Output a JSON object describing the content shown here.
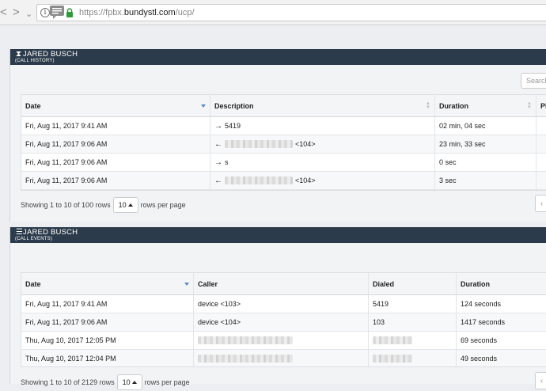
{
  "browser": {
    "back": "<",
    "forward": ">",
    "dropdown": "⌄",
    "url_prefix": "https://fpbx.",
    "url_domain": "bundystl.com",
    "url_path": "/ucp/"
  },
  "history_widget": {
    "title": "JARED BUSCH",
    "subtitle": "(CALL HISTORY)",
    "search_placeholder": "Search",
    "columns": [
      "Date",
      "Description",
      "Duration",
      "Pl"
    ],
    "rows": [
      {
        "date": "Fri, Aug 11, 2017 9:41 AM",
        "direction": "→",
        "desc": "5419",
        "duration": "02 min, 04 sec"
      },
      {
        "date": "Fri, Aug 11, 2017 9:06 AM",
        "direction": "←",
        "desc": "<104>",
        "duration": "23 min, 33 sec"
      },
      {
        "date": "Fri, Aug 11, 2017 9:06 AM",
        "direction": "→",
        "desc": "s",
        "duration": "0 sec"
      },
      {
        "date": "Fri, Aug 11, 2017 9:06 AM",
        "direction": "←",
        "desc": "<104>",
        "duration": "3 sec"
      }
    ],
    "pager": {
      "showing": "Showing 1 to 10 of 100 rows",
      "per_page": "10",
      "per_page_label": "rows per page",
      "prev": "‹"
    }
  },
  "events_widget": {
    "title": "JARED BUSCH",
    "subtitle": "(CALL EVENTS)",
    "columns": [
      "Date",
      "Caller",
      "Dialed",
      "Duration"
    ],
    "rows": [
      {
        "date": "Fri, Aug 11, 2017 9:41 AM",
        "caller": "device <103>",
        "dialed": "5419",
        "duration": "124 seconds"
      },
      {
        "date": "Fri, Aug 11, 2017 9:06 AM",
        "caller": "device <104>",
        "dialed": "103",
        "duration": "1417 seconds"
      },
      {
        "date": "Thu, Aug 10, 2017 12:05 PM",
        "caller": "",
        "dialed": "",
        "duration": "69 seconds"
      },
      {
        "date": "Thu, Aug 10, 2017 12:04 PM",
        "caller": "",
        "dialed": "",
        "duration": "49 seconds"
      }
    ],
    "pager": {
      "showing": "Showing 1 to 10 of 2129 rows",
      "per_page": "10",
      "per_page_label": "rows per page",
      "prev": "‹"
    }
  }
}
